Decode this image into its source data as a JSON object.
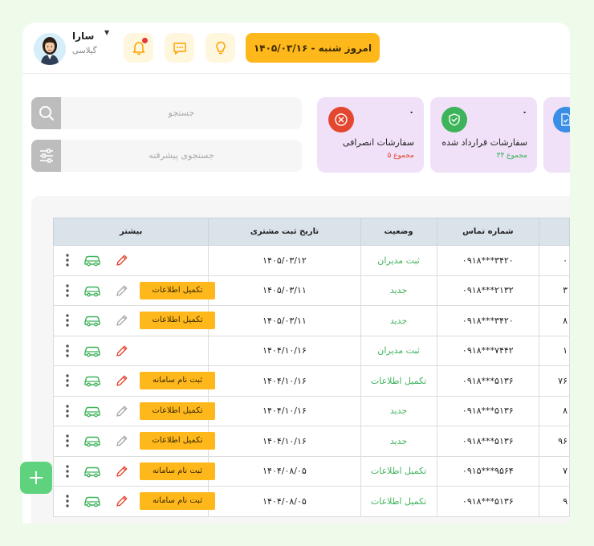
{
  "header": {
    "user_name": "سارا",
    "user_surname": "گیلاسی",
    "date_label": "امروز شنبه - ۱۴۰۵/۰۳/۱۶",
    "notification_dot_color": "#e53935"
  },
  "search": {
    "placeholder": "جستجو",
    "advanced_placeholder": "جستجوی پیشرفته"
  },
  "stats": [
    {
      "title": "سفارشات انصرافی",
      "count": "۰",
      "sum": "مجموع ۵",
      "icon": "close-circle-icon",
      "color": "#e4472f",
      "sum_color": "#e4472f"
    },
    {
      "title": "سفارشات قرارداد شده",
      "count": "۰",
      "sum": "مجموع ۳۴",
      "icon": "shield-check-icon",
      "color": "#3db35a",
      "sum_color": "#3db35a"
    },
    {
      "title": "",
      "count": "",
      "sum": "",
      "icon": "document-check-icon",
      "color": "#3a8ee6",
      "sum_color": "#3a8ee6"
    }
  ],
  "table": {
    "headers": {
      "more": "بیشتر",
      "date": "تاریخ ثبت مشتری",
      "status": "وضعیت",
      "phone": "شماره تماس"
    },
    "rows": [
      {
        "date": "۱۴۰۵/۰۳/۱۲",
        "status": "ثبت مدیران",
        "phone": "۰۹۱۸***۳۴۲۰",
        "edge": "۰",
        "action": ""
      },
      {
        "date": "۱۴۰۵/۰۳/۱۱",
        "status": "جدید",
        "phone": "۰۹۱۸***۲۱۳۲",
        "edge": "۳",
        "action": "تکمیل اطلاعات"
      },
      {
        "date": "۱۴۰۵/۰۳/۱۱",
        "status": "جدید",
        "phone": "۰۹۱۸***۳۴۲۰",
        "edge": "۸",
        "action": "تکمیل اطلاعات"
      },
      {
        "date": "۱۴۰۴/۱۰/۱۶",
        "status": "ثبت مدیران",
        "phone": "۰۹۱۸***۷۴۴۲",
        "edge": "۱",
        "action": ""
      },
      {
        "date": "۱۴۰۴/۱۰/۱۶",
        "status": "تکمیل اطلاعات",
        "phone": "۰۹۱۸***۵۱۳۶",
        "edge": "۷۶",
        "action": "ثبت نام سامانه"
      },
      {
        "date": "۱۴۰۴/۱۰/۱۶",
        "status": "جدید",
        "phone": "۰۹۱۸***۵۱۳۶",
        "edge": "۸",
        "action": "تکمیل اطلاعات"
      },
      {
        "date": "۱۴۰۴/۱۰/۱۶",
        "status": "جدید",
        "phone": "۰۹۱۸***۵۱۳۶",
        "edge": "۹۶",
        "action": "تکمیل اطلاعات"
      },
      {
        "date": "۱۴۰۴/۰۸/۰۵",
        "status": "تکمیل اطلاعات",
        "phone": "۰۹۱۵***۹۵۶۴",
        "edge": "۷",
        "action": "ثبت نام سامانه"
      },
      {
        "date": "۱۴۰۴/۰۸/۰۵",
        "status": "تکمیل اطلاعات",
        "phone": "۰۹۱۸***۵۱۳۶",
        "edge": "۹",
        "action": "ثبت نام سامانه"
      }
    ]
  },
  "colors": {
    "accent": "#ffb81c",
    "green": "#3db35a",
    "red": "#e4472f"
  }
}
